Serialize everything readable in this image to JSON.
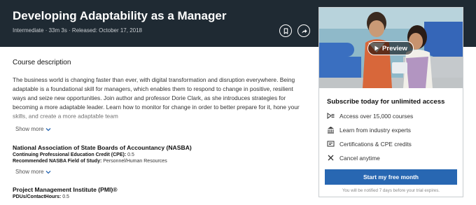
{
  "course": {
    "title": "Developing Adaptability as a Manager",
    "meta": "Intermediate · 33m 3s · Released: October 17, 2018"
  },
  "header_actions": {
    "bookmark_icon": "bookmark-icon",
    "share_icon": "share-icon"
  },
  "description": {
    "heading": "Course description",
    "text": "The business world is changing faster than ever, with digital transformation and disruption everywhere. Being adaptable is a foundational skill for managers, which enables them to respond to change in positive, resilient ways and seize new opportunities. Join author and professor Dorie Clark, as she introduces strategies for becoming a more adaptable leader. Learn how to monitor for change in order to better prepare for it, hone your skills, and create a more adaptable team",
    "show_more": "Show more"
  },
  "accreditations": [
    {
      "name": "National Association of State Boards of Accountancy (NASBA)",
      "lines": [
        {
          "label": "Continuing Professional Education Credit (CPE):",
          "value": "0.5"
        },
        {
          "label": "Recommended NASBA Field of Study:",
          "value": "Personnel/Human Resources"
        }
      ],
      "show_more": "Show more"
    },
    {
      "name": "Project Management Institute (PMI)®",
      "lines": [
        {
          "label": "PDUs/ContactHours:",
          "value": "0.5"
        }
      ]
    }
  ],
  "subscribe_card": {
    "preview_label": "Preview",
    "heading": "Subscribe today for unlimited access",
    "features": [
      {
        "icon": "play-list-icon",
        "text": "Access over 15,000 courses"
      },
      {
        "icon": "institution-icon",
        "text": "Learn from industry experts"
      },
      {
        "icon": "certificate-icon",
        "text": "Certifications & CPE credits"
      },
      {
        "icon": "close-icon",
        "text": "Cancel anytime"
      }
    ],
    "cta_label": "Start my free month",
    "fine_print": "You will be notified 7 days before your trial expires.",
    "cta_color": "#2867b2"
  }
}
